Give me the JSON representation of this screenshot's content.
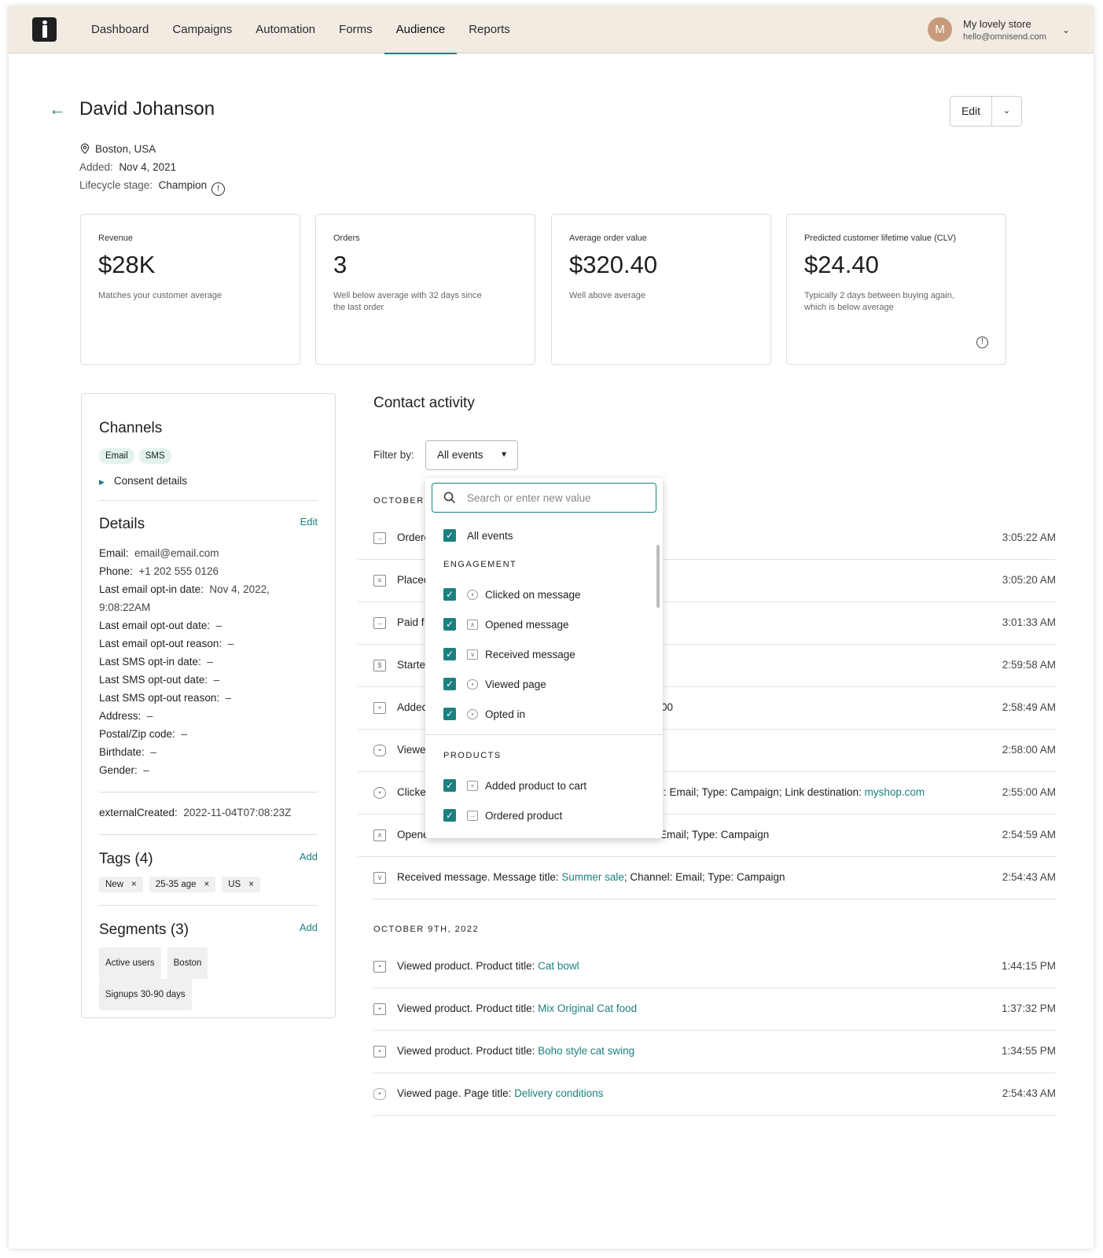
{
  "nav": {
    "items": [
      "Dashboard",
      "Campaigns",
      "Automation",
      "Forms",
      "Audience",
      "Reports"
    ],
    "active": "Audience",
    "user_initial": "M",
    "store_name": "My lovely store",
    "store_email": "hello@omnisend.com"
  },
  "contact": {
    "name": "David Johanson",
    "location": "Boston, USA",
    "added_label": "Added:",
    "added_value": "Nov 4, 2021",
    "lifecycle_label": "Lifecycle stage:",
    "lifecycle_value": "Champion",
    "edit_label": "Edit"
  },
  "stats": [
    {
      "label": "Revenue",
      "value": "$28K",
      "desc": "Matches your customer average"
    },
    {
      "label": "Orders",
      "value": "3",
      "desc": "Well below average with 32 days since the last order"
    },
    {
      "label": "Average order value",
      "value": "$320.40",
      "desc": "Well above average"
    },
    {
      "label": "Predicted customer lifetime value (CLV)",
      "value": "$24.40",
      "desc": "Typically 2 days between buying again, which is below average"
    }
  ],
  "channels": {
    "title": "Channels",
    "chips": [
      "Email",
      "SMS"
    ],
    "consent": "Consent details"
  },
  "details": {
    "title": "Details",
    "edit": "Edit",
    "fields": [
      {
        "k": "Email:",
        "v": "email@email.com"
      },
      {
        "k": "Phone:",
        "v": "+1 202 555 0126"
      },
      {
        "k": "Last email opt-in date:",
        "v": "Nov 4, 2022, 9:08:22AM"
      },
      {
        "k": "Last email opt-out date:",
        "v": "–"
      },
      {
        "k": "Last email opt-out reason:",
        "v": "–"
      },
      {
        "k": "Last SMS opt-in date:",
        "v": "–"
      },
      {
        "k": "Last SMS opt-out date:",
        "v": "–"
      },
      {
        "k": "Last SMS opt-out reason:",
        "v": "–"
      },
      {
        "k": "Address:",
        "v": "–"
      },
      {
        "k": "Postal/Zip code:",
        "v": "–"
      },
      {
        "k": "Birthdate:",
        "v": "–"
      },
      {
        "k": "Gender:",
        "v": "–"
      }
    ],
    "external_key": "externalCreated:",
    "external_value": "2022-11-04T07:08:23Z"
  },
  "tags": {
    "title": "Tags (4)",
    "add": "Add",
    "items": [
      "New",
      "25-35 age",
      "US"
    ]
  },
  "segments": {
    "title": "Segments (3)",
    "add": "Add",
    "items": [
      "Active users",
      "Boston",
      "Signups 30-90 days"
    ]
  },
  "activity": {
    "title": "Contact activity",
    "filter_label": "Filter by:",
    "filter_value": "All events",
    "group1_header": "OCTOBER 1",
    "group1": [
      {
        "pre": "Ordere",
        "time": "3:05:22 AM"
      },
      {
        "pre": "Placec",
        "time": "3:05:20 AM"
      },
      {
        "pre": "Paid f",
        "time": "3:01:33 AM"
      },
      {
        "pre": "Starte",
        "time": "2:59:58 AM"
      },
      {
        "pre": "Addec",
        "post": "00",
        "time": "2:58:49 AM"
      },
      {
        "pre": "Viewe",
        "time": "2:58:00 AM"
      },
      {
        "pre": "Clicke",
        "post": "l: Email; Type: Campaign; Link destination: ",
        "link": "myshop.com",
        "time": "2:55:00 AM"
      },
      {
        "pre": "Opene",
        "post": "Email; Type: Campaign",
        "time": "2:54:59 AM"
      },
      {
        "pre": "Received message. Message title: ",
        "link": "Summer sale",
        "post2": "; Channel: Email; Type: Campaign",
        "time": "2:54:43 AM"
      }
    ],
    "group2_header": "OCTOBER 9TH, 2022",
    "group2": [
      {
        "pre": "Viewed product. Product title: ",
        "link": "Cat bowl",
        "time": "1:44:15 PM"
      },
      {
        "pre": "Viewed product. Product title: ",
        "link": "Mix Original Cat food",
        "time": "1:37:32 PM"
      },
      {
        "pre": "Viewed product. Product title: ",
        "link": "Boho style cat swing",
        "time": "1:34:55 PM"
      },
      {
        "pre": "Viewed page. Page title: ",
        "link": "Delivery conditions",
        "time": "2:54:43 AM"
      }
    ]
  },
  "dropdown": {
    "search_placeholder": "Search or enter new value",
    "all_events": "All events",
    "engagement_header": "ENGAGEMENT",
    "engagement": [
      "Clicked on message",
      "Opened message",
      "Received message",
      "Viewed page",
      "Opted in"
    ],
    "products_header": "PRODUCTS",
    "products": [
      "Added product to cart",
      "Ordered product"
    ]
  },
  "colors": {
    "accent": "#1c8080",
    "topbar": "#f2ebe2"
  }
}
